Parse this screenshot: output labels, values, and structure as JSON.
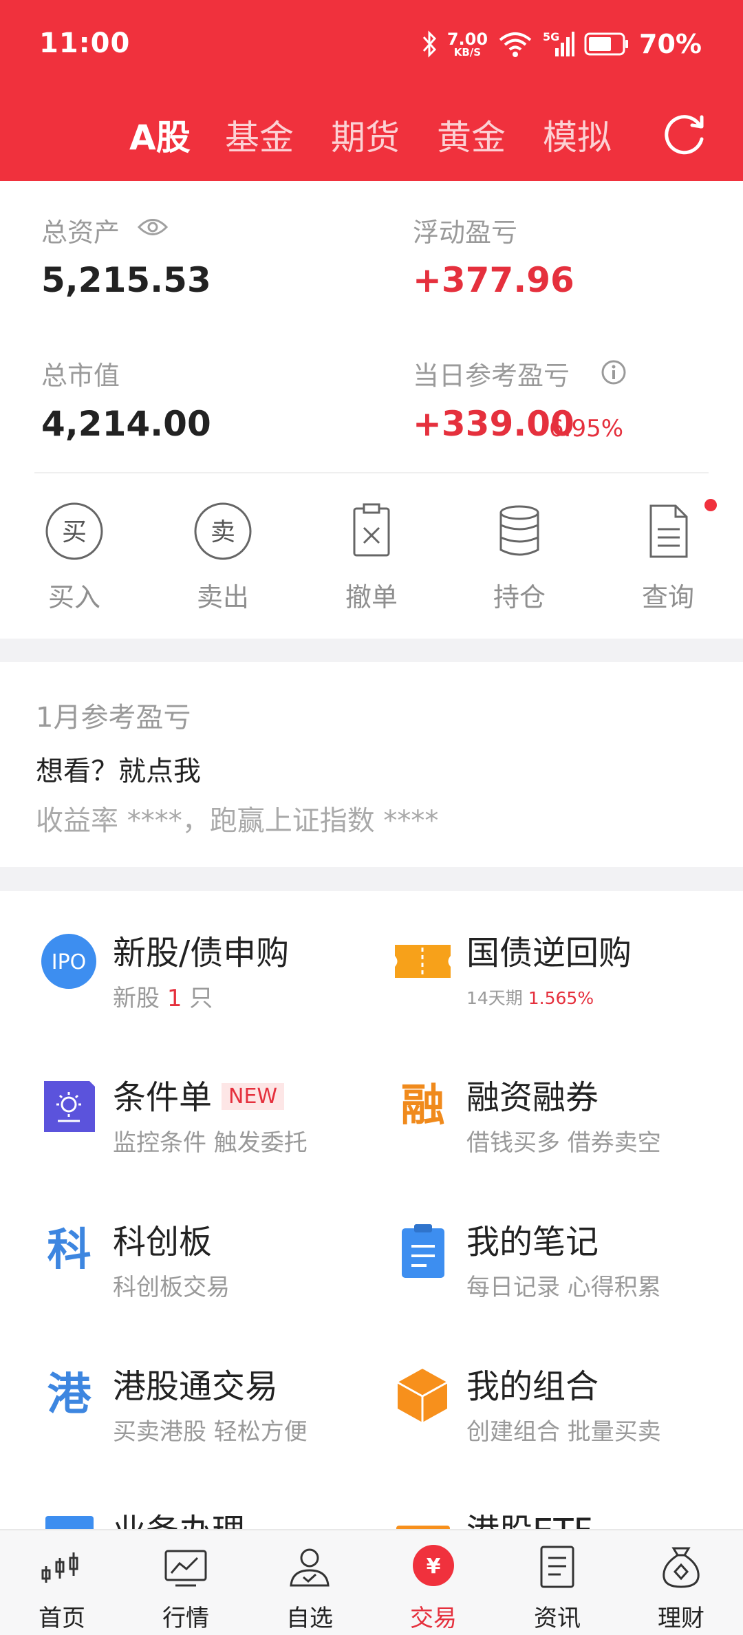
{
  "status_bar": {
    "time": "11:00",
    "net_speed_value": "7.00",
    "net_speed_unit": "KB/S",
    "network_label": "5G",
    "battery": "70%"
  },
  "tabs": [
    {
      "label": "A股",
      "active": true
    },
    {
      "label": "基金",
      "active": false
    },
    {
      "label": "期货",
      "active": false
    },
    {
      "label": "黄金",
      "active": false
    },
    {
      "label": "模拟",
      "active": false
    }
  ],
  "assets": {
    "total_assets_label": "总资产",
    "total_assets_value": "5,215.53",
    "floating_pl_label": "浮动盈亏",
    "floating_pl_value": "+377.96",
    "market_value_label": "总市值",
    "market_value_value": "4,214.00",
    "daily_pl_label": "当日参考盈亏",
    "daily_pl_value": "+339.00",
    "daily_pl_pct": "6.95%"
  },
  "actions": [
    {
      "label": "买入",
      "icon": "buy-icon",
      "glyph": "买"
    },
    {
      "label": "卖出",
      "icon": "sell-icon",
      "glyph": "卖"
    },
    {
      "label": "撤单",
      "icon": "cancel-order-icon"
    },
    {
      "label": "持仓",
      "icon": "holdings-icon"
    },
    {
      "label": "查询",
      "icon": "query-icon"
    }
  ],
  "monthly": {
    "title": "1月参考盈亏",
    "prompt": "想看？就点我",
    "summary": "收益率 ****，跑赢上证指数 ****"
  },
  "services": {
    "ipo": {
      "icon_text": "IPO",
      "title": "新股/债申购",
      "sub_prefix": "新股 ",
      "sub_count": "1",
      "sub_suffix": " 只"
    },
    "repo": {
      "title": "国债逆回购",
      "sub_prefix": "14天期 ",
      "sub_rate": "1.565%"
    },
    "conditional": {
      "title": "条件单",
      "badge": "NEW",
      "sub": "监控条件 触发委托"
    },
    "margin": {
      "icon_text": "融",
      "title": "融资融券",
      "sub": "借钱买多 借券卖空"
    },
    "star": {
      "icon_text": "科",
      "title": "科创板",
      "sub": "科创板交易"
    },
    "notes": {
      "title": "我的笔记",
      "sub": "每日记录 心得积累"
    },
    "hk": {
      "icon_text": "港",
      "title": "港股通交易",
      "sub": "买卖港股 轻松方便"
    },
    "portfolio": {
      "title": "我的组合",
      "sub": "创建组合 批量买卖"
    },
    "business": {
      "title": "业务办理"
    },
    "hk_etf": {
      "title": "港股ETF"
    }
  },
  "bottom_nav": [
    {
      "label": "首页",
      "icon": "home-candlestick-icon"
    },
    {
      "label": "行情",
      "icon": "market-chart-icon"
    },
    {
      "label": "自选",
      "icon": "watchlist-person-icon"
    },
    {
      "label": "交易",
      "icon": "trade-yuan-icon",
      "active": true,
      "glyph": "¥"
    },
    {
      "label": "资讯",
      "icon": "news-icon"
    },
    {
      "label": "理财",
      "icon": "wealth-bag-icon"
    }
  ],
  "colors": {
    "brand_red": "#f0313d",
    "gain_red": "#e5303d",
    "ipo_blue": "#3d8ef0",
    "repo_orange": "#f7a11a",
    "conditional_purple": "#5b53dc",
    "margin_orange": "#f08a1c",
    "star_blue": "#3d86e0",
    "notes_blue": "#3d8ef0",
    "portfolio_orange": "#f7901c"
  }
}
